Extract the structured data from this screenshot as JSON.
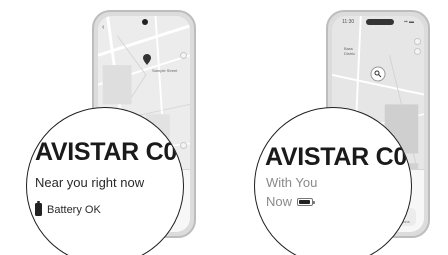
{
  "left_view": {
    "map_label": "Sample Street",
    "magnifier": {
      "device_name": "AVISTAR C0",
      "location_status": "Near you right now",
      "battery_status": "Battery OK",
      "battery_icon": "battery-vertical-icon"
    }
  },
  "right_view": {
    "status_time": "11:30",
    "status_icons": "▪▪ ▬",
    "map_labels": [
      "Bass",
      "Distric"
    ],
    "sheet_labels": [
      "Directions"
    ],
    "magnifier": {
      "device_name": "AVISTAR C0",
      "line1": "With You",
      "line2": "Now",
      "battery_icon": "battery-horizontal-icon"
    }
  },
  "colors": {
    "text_primary": "#1a1a1a",
    "text_muted": "#8a8a8a",
    "map_bg": "#e9e9e9",
    "outline": "#1f1f1f"
  }
}
